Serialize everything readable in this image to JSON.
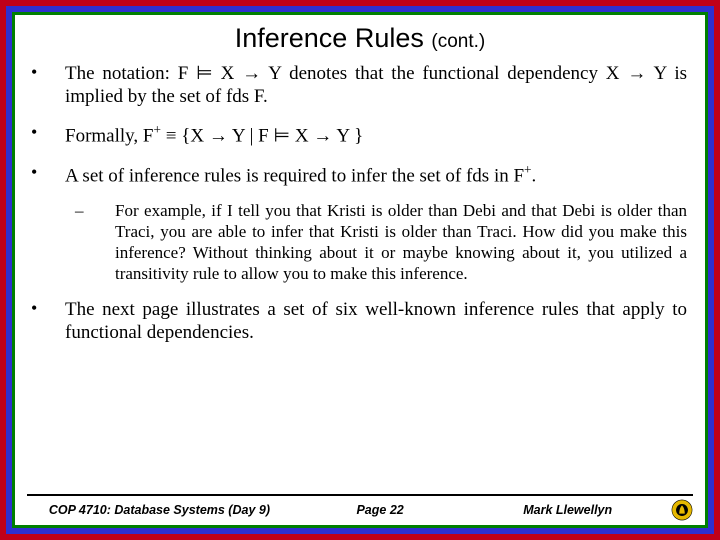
{
  "title": {
    "main": "Inference Rules",
    "cont": "(cont.)"
  },
  "bullets": {
    "b1a": "The notation: F ",
    "b1b": " X ",
    "b1c": " Y denotes that the functional dependency X ",
    "b1d": " Y is implied by the set of fds F.",
    "b2a": "Formally, F",
    "b2b": " ≡ {X ",
    "b2c": " Y | F ",
    "b2d": " X ",
    "b2e": " Y }",
    "b3a": "A set of inference rules is required to infer the set of fds in F",
    "b3b": ".",
    "sub1": "For example, if I tell you that Kristi is older than Debi and that Debi is older than Traci, you are able to infer that Kristi is older than Traci.  How did you make this inference?  Without thinking about it or maybe knowing about it, you utilized a transitivity rule to allow you to make this inference.",
    "b4": "The next page illustrates a set of six well-known inference rules that apply to functional dependencies."
  },
  "sym": {
    "entails": "⊨",
    "arrow": "→",
    "plus": "+"
  },
  "footer": {
    "course": "COP 4710: Database Systems (Day 9)",
    "page": "Page 22",
    "author": "Mark Llewellyn"
  }
}
